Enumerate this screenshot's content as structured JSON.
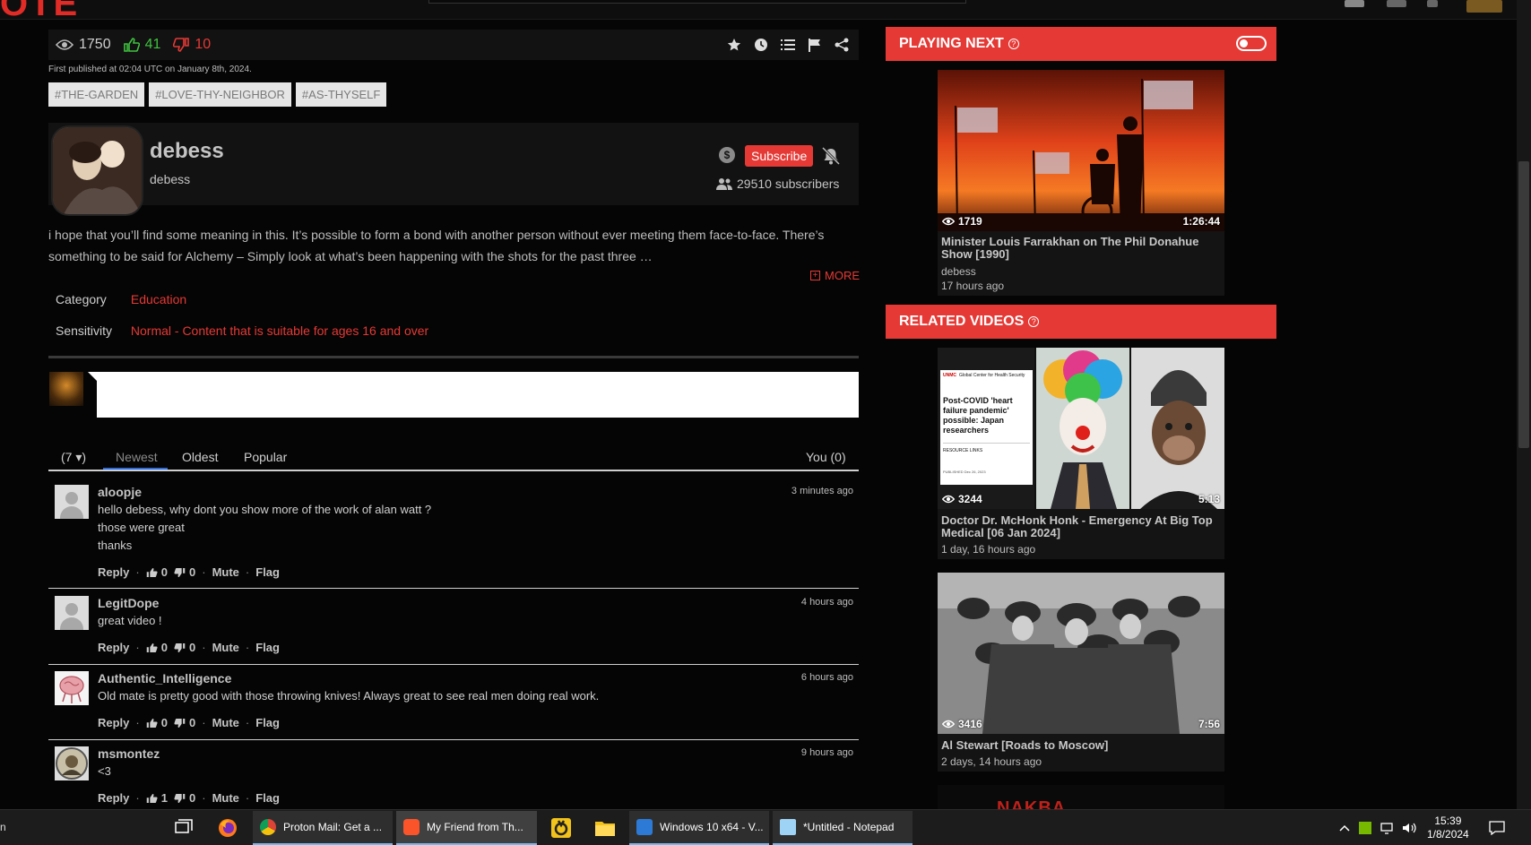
{
  "topbar": {
    "logo_fragment": "OTE"
  },
  "stats": {
    "views": "1750",
    "likes": "41",
    "dislikes": "10"
  },
  "published": "First published at 02:04 UTC on January 8th, 2024.",
  "tags": [
    "#THE-GARDEN",
    "#LOVE-THY-NEIGHBOR",
    "#AS-THYSELF"
  ],
  "channel": {
    "name": "debess",
    "handle": "debess",
    "subscribe_label": "Subscribe",
    "subscribers": "29510 subscribers",
    "dollar": "$"
  },
  "description": {
    "text": "i hope that you’ll find some meaning in this. It’s possible to form a bond with another person without ever meeting them face-to-face. There’s something to be said for Alchemy – Simply look at what’s been happening with the shots for the past three …",
    "more_label": "MORE",
    "more_icon": "+"
  },
  "meta": {
    "category_label": "Category",
    "category_value": "Education",
    "sensitivity_label": "Sensitivity",
    "sensitivity_value": "Normal - Content that is suitable for ages 16 and over"
  },
  "comment_tabs": {
    "count": "(7 ▾)",
    "newest": "Newest",
    "oldest": "Oldest",
    "popular": "Popular",
    "you": "You (0)"
  },
  "comments": [
    {
      "user": "aloopje",
      "time": "3 minutes ago",
      "lines": [
        "hello debess, why dont you show more of the work of alan watt ?",
        "those were great",
        "thanks"
      ],
      "up": "0",
      "down": "0"
    },
    {
      "user": "LegitDope",
      "time": "4 hours ago",
      "lines": [
        "great video !"
      ],
      "up": "0",
      "down": "0"
    },
    {
      "user": "Authentic_Intelligence",
      "time": "6 hours ago",
      "lines": [
        "Old mate is pretty good with those throwing knives! Always great to see real men doing real work."
      ],
      "up": "0",
      "down": "0"
    },
    {
      "user": "msmontez",
      "time": "9 hours ago",
      "lines": [
        "<3"
      ],
      "up": "1",
      "down": "0"
    }
  ],
  "comment_actions": {
    "reply": "Reply",
    "mute": "Mute",
    "flag": "Flag",
    "sep": "·"
  },
  "playing_next": {
    "header": "PLAYING NEXT",
    "help_icon": "?",
    "video": {
      "views": "1719",
      "duration": "1:26:44",
      "title": "Minister Louis Farrakhan on The Phil Donahue Show [1990]",
      "channel": "debess",
      "age": "17 hours ago"
    }
  },
  "related": {
    "header": "RELATED VIDEOS",
    "help_icon": "?",
    "videos": [
      {
        "views": "3244",
        "duration": "5:13",
        "title": "Doctor Dr. McHonk Honk - Emergency At Big Top Medical [06 Jan 2024]",
        "age": "1 day, 16 hours ago",
        "thumb_text": {
          "org": "Global Center for Health Security",
          "unmc": "UNMC",
          "headline": "Post-COVID 'heart failure pandemic' possible: Japan researchers",
          "links": "RESOURCE LINKS",
          "published": "PUBLISHED Dec 26, 2023"
        }
      },
      {
        "views": "3416",
        "duration": "7:56",
        "title": "Al Stewart [Roads to Moscow]",
        "age": "2 days, 14 hours ago"
      },
      {
        "partial_title": "NAKBA"
      }
    ]
  },
  "taskbar": {
    "left_fragment": "n",
    "apps": [
      "Proton Mail: Get a ...",
      "My Friend from Th...",
      "Windows 10 x64 - V...",
      "*Untitled - Notepad"
    ],
    "time": "15:39",
    "date": "1/8/2024"
  },
  "colors": {
    "accent": "#e53935",
    "like": "#3fc23f",
    "background": "#050505",
    "panel": "#121212"
  }
}
